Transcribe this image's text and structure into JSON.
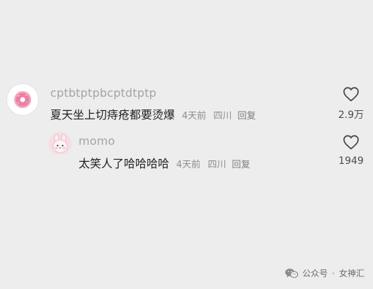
{
  "comments": [
    {
      "username": "cptbtptpbcptdtptp",
      "text": "夏天坐上切痔疮都要烫爆",
      "time": "4天前",
      "location": "四川",
      "reply_label": "回复",
      "likes": "2.9万",
      "avatar_icon": "donut-avatar-icon"
    },
    {
      "username": "momo",
      "text": "太笑人了哈哈哈哈",
      "time": "4天前",
      "location": "四川",
      "reply_label": "回复",
      "likes": "1949",
      "avatar_icon": "pink-bunny-avatar-icon"
    }
  ],
  "watermark": {
    "source": "公众号",
    "separator": "·",
    "account": "女神汇",
    "icon": "wechat-icon"
  }
}
